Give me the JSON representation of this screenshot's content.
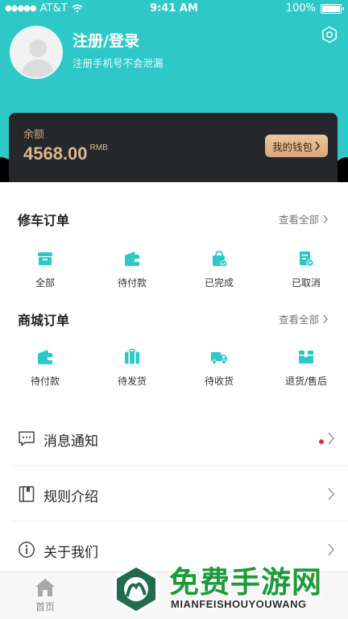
{
  "status_bar": {
    "carrier": "AT&T",
    "time": "9:41 AM",
    "battery": "100%"
  },
  "profile": {
    "title": "注册/登录",
    "subtitle": "注册手机号不会泄漏"
  },
  "wallet": {
    "label": "余额",
    "amount": "4568.00",
    "unit": "RMB",
    "button": "我的钱包"
  },
  "repair_orders": {
    "title": "修车订单",
    "view_all": "查看全部",
    "items": [
      {
        "label": "全部",
        "icon": "box-icon"
      },
      {
        "label": "待付款",
        "icon": "wallet-icon"
      },
      {
        "label": "已完成",
        "icon": "bag-check-icon"
      },
      {
        "label": "已取消",
        "icon": "document-cancel-icon"
      }
    ]
  },
  "mall_orders": {
    "title": "商城订单",
    "view_all": "查看全部",
    "items": [
      {
        "label": "待付款",
        "icon": "wallet-icon"
      },
      {
        "label": "待发货",
        "icon": "luggage-icon"
      },
      {
        "label": "待收货",
        "icon": "truck-icon"
      },
      {
        "label": "退货/售后",
        "icon": "return-box-icon"
      }
    ]
  },
  "menu": [
    {
      "label": "消息通知",
      "icon": "message-icon"
    },
    {
      "label": "规则介绍",
      "icon": "book-icon"
    },
    {
      "label": "关于我们",
      "icon": "info-icon"
    }
  ],
  "tabbar": {
    "home": "首页"
  },
  "watermark": {
    "title": "免费手游网",
    "subtitle": "MIANFEISHOUYOUWANG"
  },
  "colors": {
    "accent": "#2ec8c8",
    "gold": "#d8b98a",
    "card": "#25272b"
  }
}
